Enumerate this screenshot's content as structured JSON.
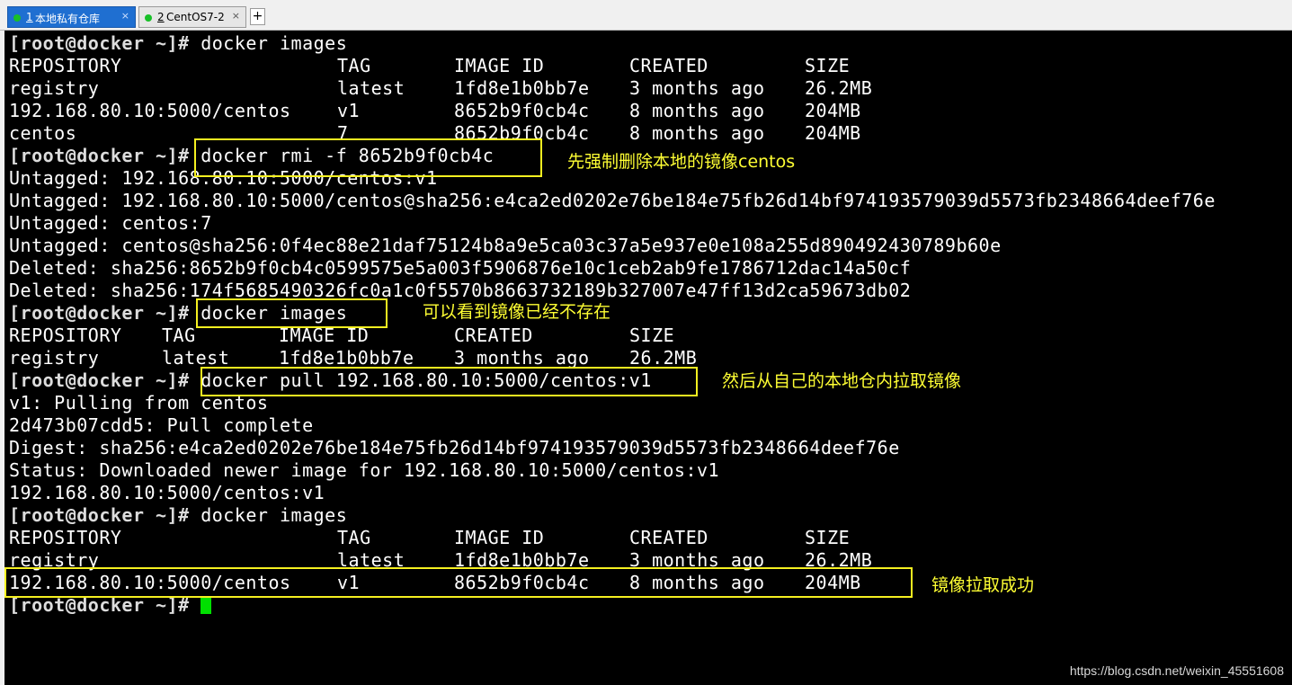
{
  "tabs": [
    {
      "num": "1",
      "label": " 本地私有仓库",
      "close": "×",
      "active": true
    },
    {
      "num": "2",
      "label": " CentOS7-2",
      "close": "×",
      "active": false
    }
  ],
  "add_tab": "+",
  "prompt": "[root@docker ~]#",
  "lines": {
    "l1_cmd": " docker images",
    "h1": {
      "repo": "REPOSITORY",
      "tag": "TAG",
      "id": "IMAGE ID",
      "created": "CREATED",
      "size": "SIZE"
    },
    "r1": {
      "repo": "registry",
      "tag": "latest",
      "id": "1fd8e1b0bb7e",
      "created": "3 months ago",
      "size": "26.2MB"
    },
    "r2": {
      "repo": "192.168.80.10:5000/centos",
      "tag": "v1",
      "id": "8652b9f0cb4c",
      "created": "8 months ago",
      "size": "204MB"
    },
    "r3": {
      "repo": "centos",
      "tag": "7",
      "id": "8652b9f0cb4c",
      "created": "8 months ago",
      "size": "204MB"
    },
    "l5_cmd": " docker rmi -f 8652b9f0cb4c",
    "l6": "Untagged: 192.168.80.10:5000/centos:v1",
    "l7": "Untagged: 192.168.80.10:5000/centos@sha256:e4ca2ed0202e76be184e75fb26d14bf974193579039d5573fb2348664deef76e",
    "l8": "Untagged: centos:7",
    "l9": "Untagged: centos@sha256:0f4ec88e21daf75124b8a9e5ca03c37a5e937e0e108a255d890492430789b60e",
    "l10": "Deleted: sha256:8652b9f0cb4c0599575e5a003f5906876e10c1ceb2ab9fe1786712dac14a50cf",
    "l11": "Deleted: sha256:174f5685490326fc0a1c0f5570b8663732189b327007e47ff13d2ca59673db02",
    "l12_cmd": " docker images",
    "h2": {
      "repo": "REPOSITORY",
      "tag": "TAG",
      "id": "IMAGE ID",
      "created": "CREATED",
      "size": "SIZE"
    },
    "r4": {
      "repo": "registry",
      "tag": "latest",
      "id": "1fd8e1b0bb7e",
      "created": "3 months ago",
      "size": "26.2MB"
    },
    "l15_cmd": " docker pull 192.168.80.10:5000/centos:v1",
    "l16": "v1: Pulling from centos",
    "l17": "2d473b07cdd5: Pull complete",
    "l18": "Digest: sha256:e4ca2ed0202e76be184e75fb26d14bf974193579039d5573fb2348664deef76e",
    "l19": "Status: Downloaded newer image for 192.168.80.10:5000/centos:v1",
    "l20": "192.168.80.10:5000/centos:v1",
    "l21_cmd": " docker images",
    "h3": {
      "repo": "REPOSITORY",
      "tag": "TAG",
      "id": "IMAGE ID",
      "created": "CREATED",
      "size": "SIZE"
    },
    "r5": {
      "repo": "registry",
      "tag": "latest",
      "id": "1fd8e1b0bb7e",
      "created": "3 months ago",
      "size": "26.2MB"
    },
    "r6": {
      "repo": "192.168.80.10:5000/centos",
      "tag": "v1",
      "id": "8652b9f0cb4c",
      "created": "8 months ago",
      "size": "204MB"
    }
  },
  "annotations": {
    "rmi": "先强制删除本地的镜像centos",
    "gone": "可以看到镜像已经不存在",
    "pull": "然后从自己的本地仓内拉取镜像",
    "ok": "镜像拉取成功"
  },
  "colors": {
    "highlight": "#f5f020",
    "cursor": "#00e000",
    "tab_active": "#1f6fd1"
  },
  "watermark": "https://blog.csdn.net/weixin_45551608"
}
